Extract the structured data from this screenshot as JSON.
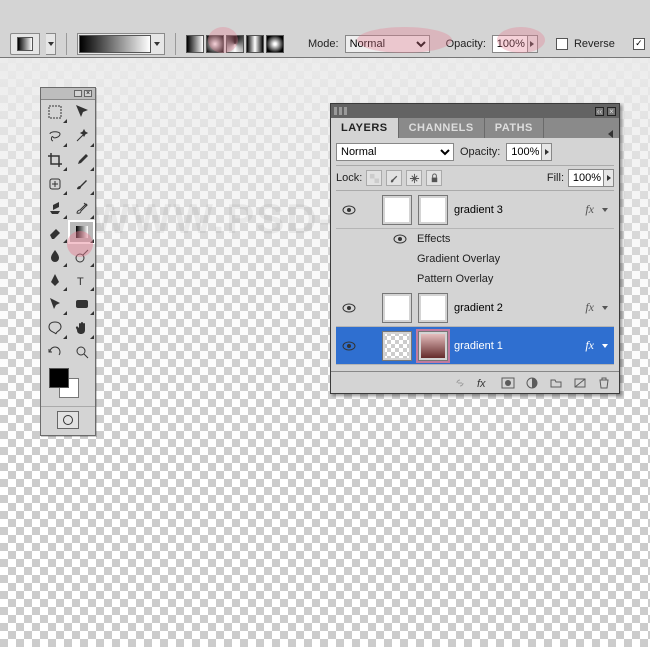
{
  "watermark": "WWW.PSD-DUDE.COM",
  "options_bar": {
    "mode_label": "Mode:",
    "mode_value": "Normal",
    "opacity_label": "Opacity:",
    "opacity_value": "100%",
    "reverse_label": "Reverse",
    "reverse_checked": false,
    "dither_checked": true,
    "gradient_styles": [
      "linear",
      "radial",
      "angle",
      "reflected",
      "diamond"
    ],
    "selected_style": "linear"
  },
  "toolbox": {
    "tools": [
      "marquee",
      "move",
      "lasso",
      "magic-wand",
      "crop",
      "eyedropper",
      "healing-brush",
      "brush",
      "clone-stamp",
      "history-brush",
      "eraser",
      "gradient",
      "blur",
      "dodge",
      "pen",
      "type",
      "path-select",
      "shape",
      "notes",
      "hand",
      "rotate-view",
      "zoom"
    ],
    "selected_tool": "gradient",
    "foreground": "#000000",
    "background": "#ffffff"
  },
  "layers_panel": {
    "tabs": [
      "LAYERS",
      "CHANNELS",
      "PATHS"
    ],
    "active_tab": "LAYERS",
    "blend_mode": "Normal",
    "opacity_label": "Opacity:",
    "opacity_value": "100%",
    "lock_label": "Lock:",
    "fill_label": "Fill:",
    "fill_value": "100%",
    "effects_label": "Effects",
    "effect_items": [
      "Gradient Overlay",
      "Pattern Overlay"
    ],
    "layers": [
      {
        "name": "gradient 3",
        "visible": true,
        "has_fx": true,
        "selected": false,
        "thumb": "white"
      },
      {
        "name": "gradient 2",
        "visible": true,
        "has_fx": true,
        "selected": false,
        "thumb": "white"
      },
      {
        "name": "gradient 1",
        "visible": true,
        "has_fx": true,
        "selected": true,
        "thumb": "grad"
      }
    ],
    "footer_icons": [
      "link",
      "fx",
      "mask",
      "adjust",
      "group",
      "new",
      "trash"
    ]
  }
}
